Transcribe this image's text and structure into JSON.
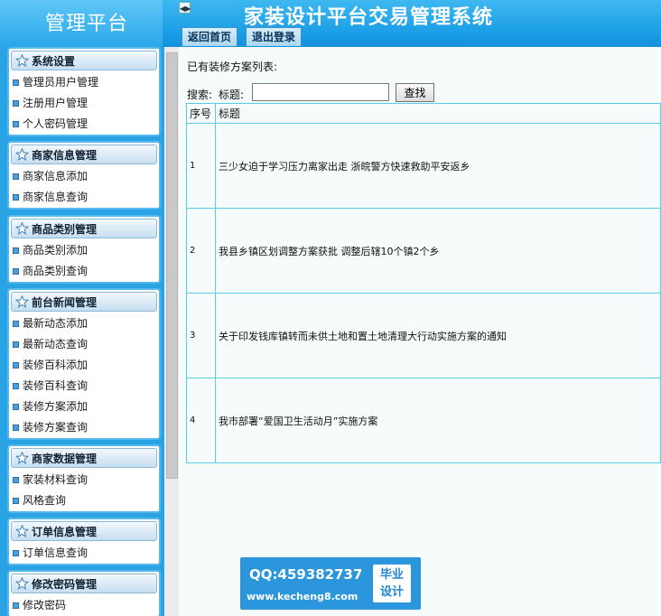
{
  "header": {
    "brand": "管理平台",
    "system_title": "家装设计平台交易管理系统",
    "toggle_icon": "◀▶",
    "tabs": [
      {
        "label": "返回首页"
      },
      {
        "label": "退出登录"
      }
    ],
    "colors": {
      "header_bg": "#1a9ee6",
      "text": "#ffffff"
    }
  },
  "sidebar": {
    "icon": "star-icon",
    "panels": [
      {
        "title": "系统设置",
        "items": [
          "管理员用户管理",
          "注册用户管理",
          "个人密码管理"
        ]
      },
      {
        "title": "商家信息管理",
        "items": [
          "商家信息添加",
          "商家信息查询"
        ]
      },
      {
        "title": "商品类别管理",
        "items": [
          "商品类别添加",
          "商品类别查询"
        ]
      },
      {
        "title": "前台新闻管理",
        "items": [
          "最新动态添加",
          "最新动态查询",
          "装修百科添加",
          "装修百科查询",
          "装修方案添加",
          "装修方案查询"
        ]
      },
      {
        "title": "商家数据管理",
        "items": [
          "家装材料查询",
          "风格查询"
        ]
      },
      {
        "title": "订单信息管理",
        "items": [
          "订单信息查询"
        ]
      },
      {
        "title": "修改密码管理",
        "items": [
          "修改密码"
        ]
      }
    ]
  },
  "main": {
    "list_heading": "已有装修方案列表:",
    "search": {
      "label": "搜索:",
      "field_label": "标题:",
      "value": "",
      "button": "查找"
    },
    "table": {
      "headers": [
        "序号",
        "标题"
      ],
      "rows": [
        {
          "no": "1",
          "title": "三少女迫于学习压力离家出走 浙皖警方快速救助平安返乡"
        },
        {
          "no": "2",
          "title": "我县乡镇区划调整方案获批 调整后辖10个镇2个乡"
        },
        {
          "no": "3",
          "title": "关于印发钱库镇转而未供土地和置土地清理大行动实施方案的通知"
        },
        {
          "no": "4",
          "title": "我市部署“爱国卫生活动月”实施方案"
        }
      ]
    }
  },
  "watermark": {
    "qq": "QQ:459382737",
    "site": "www.kecheng8.com",
    "badge_line1": "毕业",
    "badge_line2": "设计"
  }
}
